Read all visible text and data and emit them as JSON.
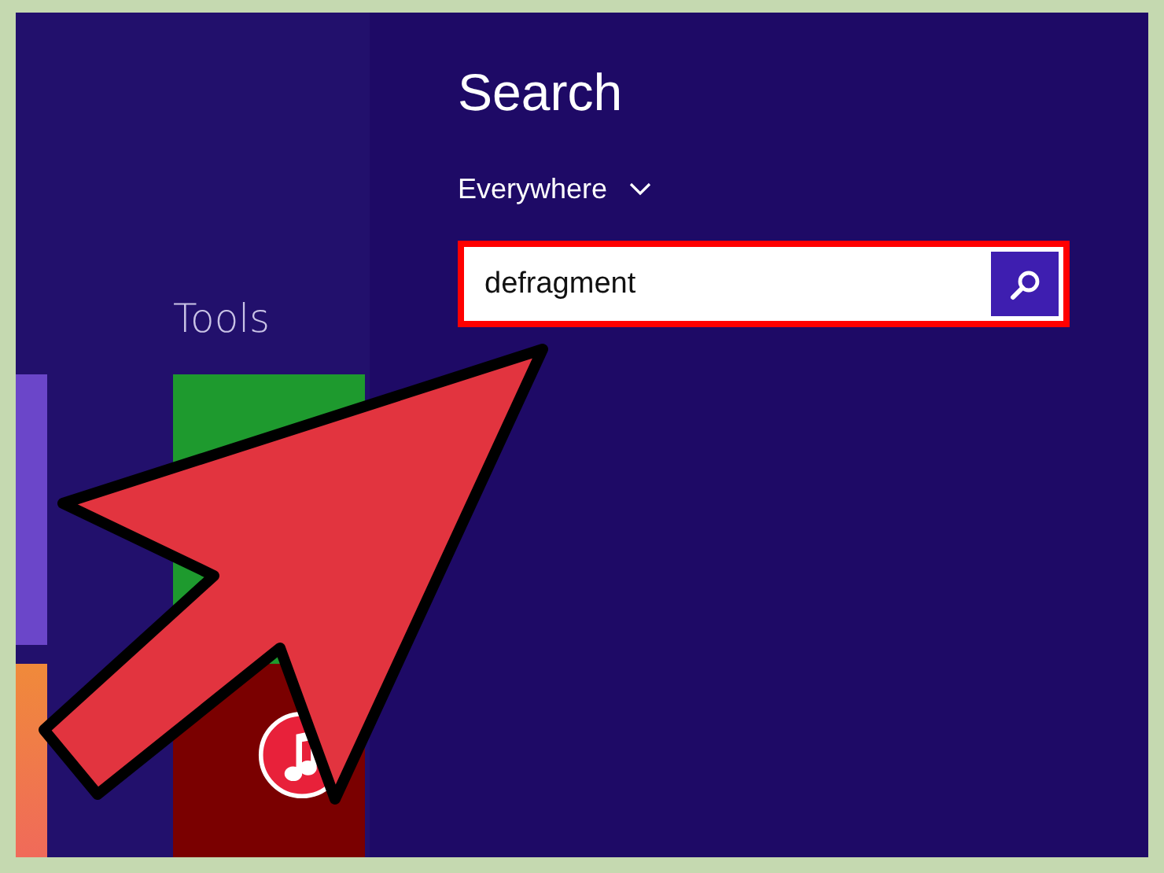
{
  "start_screen": {
    "group_label": "Tools"
  },
  "search_pane": {
    "title": "Search",
    "scope": "Everywhere",
    "search_field": {
      "value": "defragment"
    }
  }
}
